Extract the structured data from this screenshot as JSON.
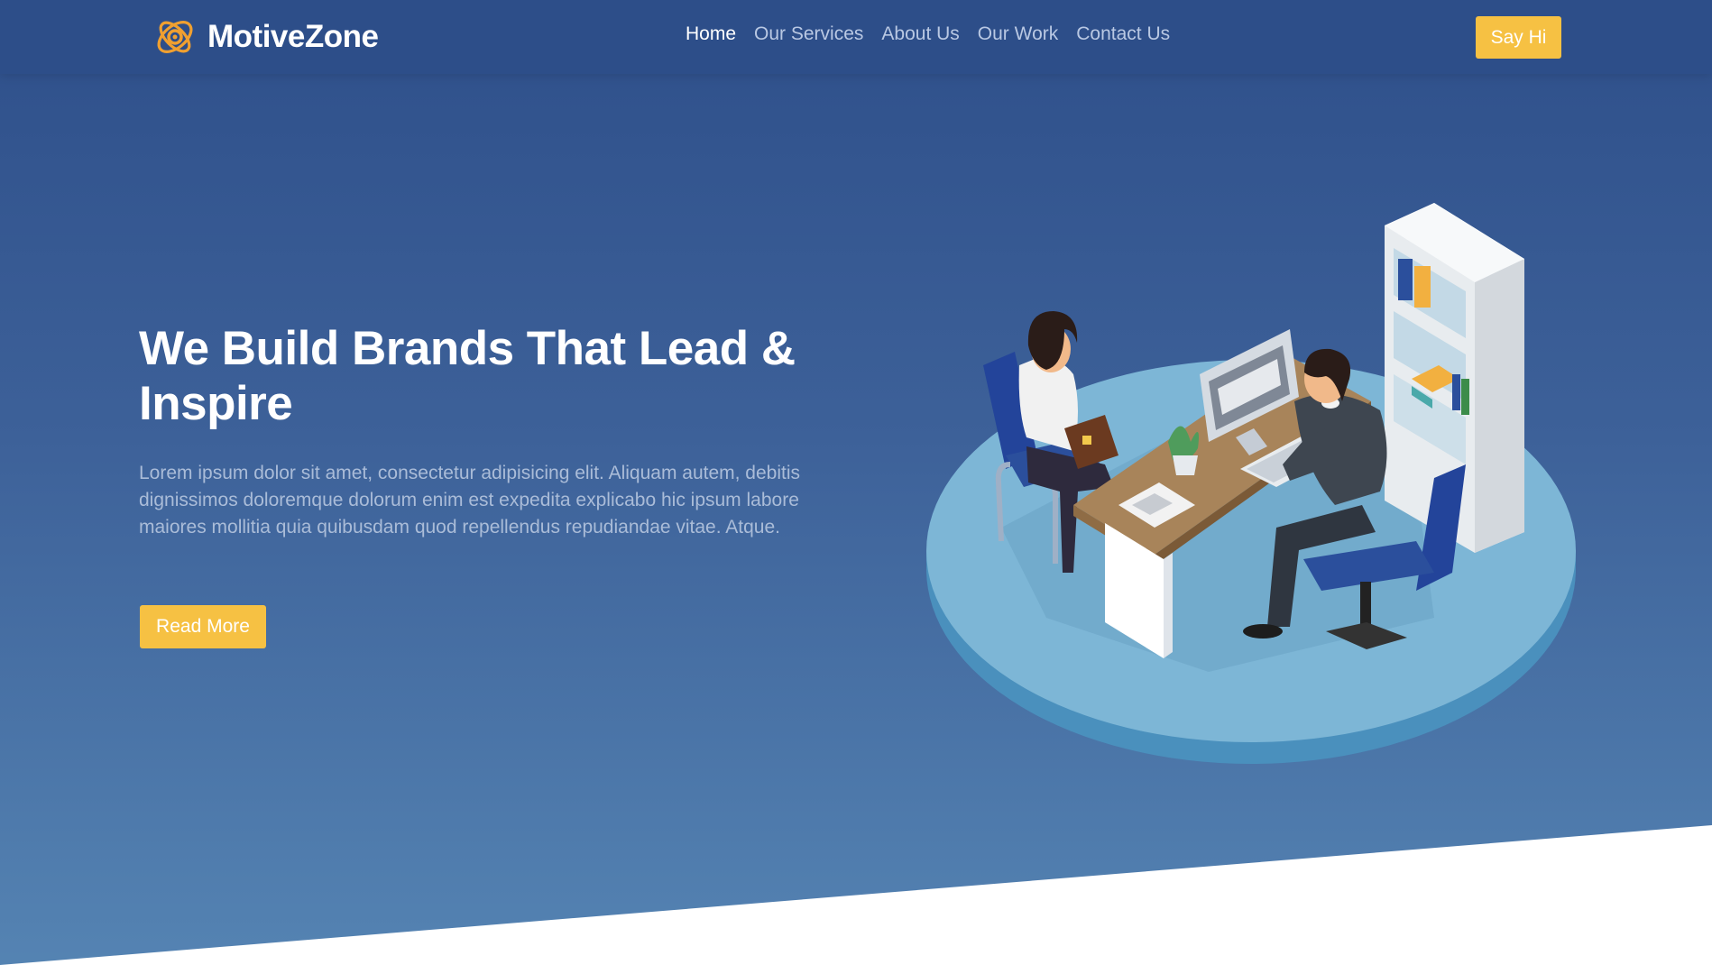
{
  "brand": {
    "name": "MotiveZone",
    "logo_icon": "orbit-logo-icon",
    "accent": "#f0a030"
  },
  "nav": {
    "items": [
      {
        "label": "Home",
        "active": true
      },
      {
        "label": "Our Services",
        "active": false
      },
      {
        "label": "About Us",
        "active": false
      },
      {
        "label": "Our Work",
        "active": false
      },
      {
        "label": "Contact Us",
        "active": false
      }
    ],
    "cta_label": "Say Hi"
  },
  "hero": {
    "headline": "We Build Brands That Lead & Inspire",
    "paragraph": "Lorem ipsum dolor sit amet, consectetur adipisicing elit. Aliquam autem, debitis dignissimos doloremque dolorum enim est expedita explicabo hic ipsum labore maiores mollitia quia quibusdam quod repellendus repudiandae vitae. Atque.",
    "button_label": "Read More",
    "illustration": "office-meeting-illustration"
  },
  "colors": {
    "navbar": "#2d4e89",
    "hero_top": "#2e4f8a",
    "hero_bottom": "#5584b3",
    "button": "#f6c143",
    "nav_text": "#b9c8e3",
    "nav_active": "#ffffff"
  }
}
